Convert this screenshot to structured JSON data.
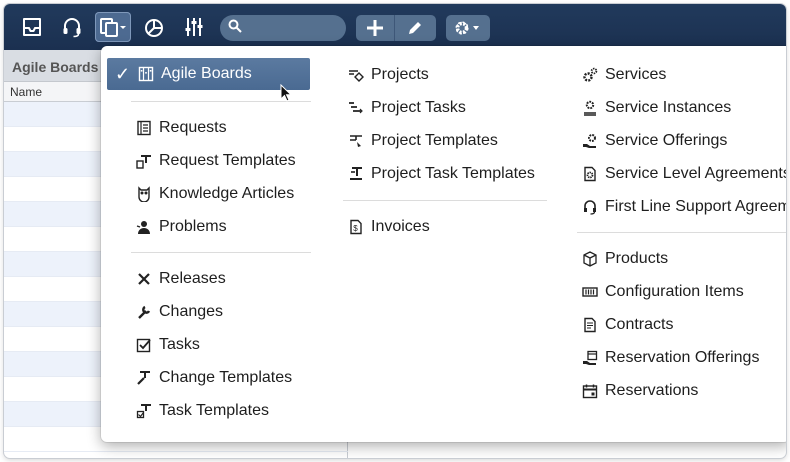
{
  "toolbar": {
    "icons": [
      "inbox-icon",
      "headset-icon",
      "records-menu-icon",
      "analytics-icon",
      "settings-sliders-icon",
      "search-icon",
      "add-icon",
      "edit-icon",
      "gear-menu-icon"
    ],
    "search": {
      "value": "",
      "placeholder": ""
    }
  },
  "panel": {
    "title": "Agile Boards",
    "column_header": "Name"
  },
  "menu": {
    "col1": [
      {
        "label": "Agile Boards",
        "icon": "agile-board-icon",
        "selected": true
      },
      {
        "label": "Requests",
        "icon": "requests-icon"
      },
      {
        "label": "Request Templates",
        "icon": "request-templates-icon"
      },
      {
        "label": "Knowledge Articles",
        "icon": "owl-icon"
      },
      {
        "label": "Problems",
        "icon": "problems-icon"
      },
      {
        "label": "Releases",
        "icon": "releases-icon"
      },
      {
        "label": "Changes",
        "icon": "wrench-icon"
      },
      {
        "label": "Tasks",
        "icon": "task-checkbox-icon"
      },
      {
        "label": "Change Templates",
        "icon": "change-templates-icon"
      },
      {
        "label": "Task Templates",
        "icon": "task-templates-icon"
      }
    ],
    "col2": [
      {
        "label": "Projects",
        "icon": "projects-icon"
      },
      {
        "label": "Project Tasks",
        "icon": "project-tasks-icon"
      },
      {
        "label": "Project Templates",
        "icon": "project-templates-icon"
      },
      {
        "label": "Project Task Templates",
        "icon": "project-task-templates-icon"
      },
      {
        "label": "Invoices",
        "icon": "invoice-icon"
      }
    ],
    "col3": [
      {
        "label": "Services",
        "icon": "services-icon"
      },
      {
        "label": "Service Instances",
        "icon": "service-instances-icon"
      },
      {
        "label": "Service Offerings",
        "icon": "service-offerings-icon"
      },
      {
        "label": "Service Level Agreements",
        "icon": "sla-icon"
      },
      {
        "label": "First Line Support Agreem",
        "icon": "first-line-support-icon"
      },
      {
        "label": "Products",
        "icon": "products-box-icon"
      },
      {
        "label": "Configuration Items",
        "icon": "configuration-items-icon"
      },
      {
        "label": "Contracts",
        "icon": "contract-icon"
      },
      {
        "label": "Reservation Offerings",
        "icon": "reservation-offerings-icon"
      },
      {
        "label": "Reservations",
        "icon": "calendar-icon"
      }
    ]
  },
  "colors": {
    "toolbar": "#1e3556",
    "selected": "#53739a",
    "row_alt": "#edf2fb"
  }
}
